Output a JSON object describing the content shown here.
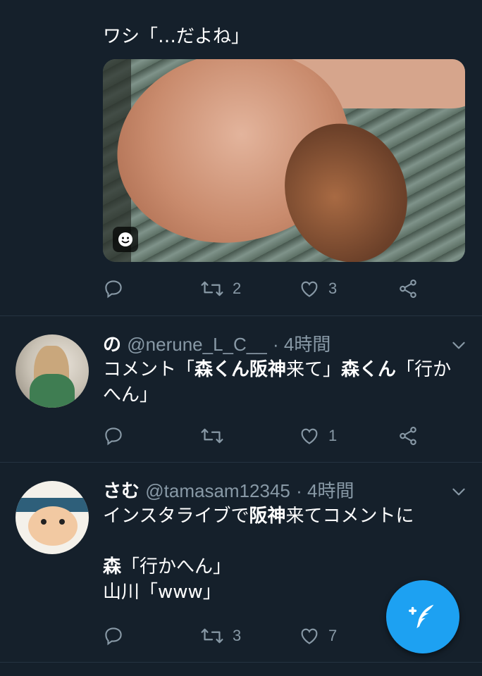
{
  "tweet1": {
    "text": "ワシ「…だよね」",
    "actions": {
      "reply": "",
      "retweet": "2",
      "like": "3"
    }
  },
  "tweet2": {
    "name": "の",
    "handle": "@nerune_L_C__",
    "time": "· 4時間",
    "text_parts": [
      "コメント「",
      "森くん阪神",
      "来て」",
      "森くん",
      "「行かへん」"
    ],
    "actions": {
      "reply": "",
      "retweet": "",
      "like": "1"
    }
  },
  "tweet3": {
    "name": "さむ",
    "handle": "@tamasam12345",
    "time": "· 4時間",
    "line1_parts": [
      "インスタライブで",
      "阪神",
      "来てコメントに"
    ],
    "line2_parts": [
      "森",
      "「行かへん」"
    ],
    "line3": "山川「www」",
    "actions": {
      "reply": "",
      "retweet": "3",
      "like": "7"
    }
  },
  "colors": {
    "background": "#15202b",
    "muted": "#8899a6",
    "accent": "#1da1f2"
  },
  "icons": [
    "reply-icon",
    "retweet-icon",
    "like-icon",
    "share-icon",
    "chevron-down-icon",
    "compose-tweet-icon",
    "gif-face-icon"
  ]
}
